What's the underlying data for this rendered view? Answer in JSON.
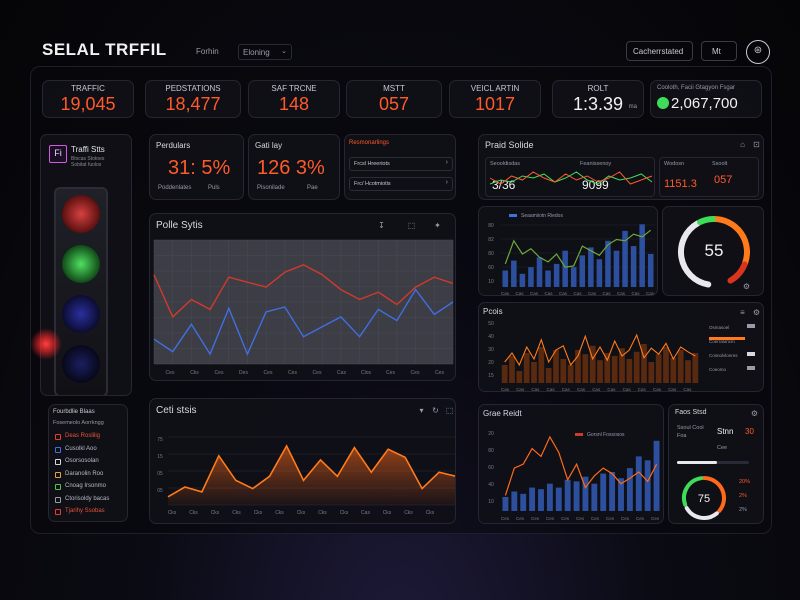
{
  "header": {
    "title": "SELAL TRFFIL",
    "nav_label": "Forhin",
    "dropdown_value": "Eloning",
    "right_button": "Cacherrstated",
    "small_button": "Mt"
  },
  "stats": [
    {
      "label": "TRAFFIC",
      "value": "19,045",
      "unit": ""
    },
    {
      "label": "PEDSTATIONS",
      "value": "18,477",
      "unit": ""
    },
    {
      "label": "SAF TRCNE",
      "value": "148",
      "unit": ""
    },
    {
      "label": "MSTT",
      "value": "057",
      "unit": ""
    },
    {
      "label": "VEICL ARTIN",
      "value": "1017",
      "unit": ""
    },
    {
      "label": "ROLT",
      "value": "1:3.39",
      "unit": "ma"
    }
  ],
  "stat_wide": {
    "label": "Cooloth, Facii Gtagyon Fsgar",
    "value": "2,067,700"
  },
  "left_panel": {
    "title": "Traffi Stts",
    "lines": [
      "Blocas Stotoes",
      "Sobitat fuolos"
    ],
    "legend_title": "Fourbdlie Blaas",
    "legend_sub": "Fosemeolo Aorrkngg",
    "legend_items": [
      "Deas Roslilig",
      "Cusolkl Aoo",
      "Osorsosolan",
      "Daranolin Roo",
      "Cnoag Irsonmo",
      "Ctorisoldy bacas",
      "Tjarihy Ssobas"
    ],
    "legend_colors": [
      "#e63b2e",
      "#3f6fe0",
      "#d8d8e0",
      "#e6a23b",
      "#5cbf4a",
      "#9a9aaa",
      "#e63b2e"
    ]
  },
  "mini_stats": {
    "a_label": "Perdulars",
    "a_value": "31: 5%",
    "a_sub1": "Poddenlates",
    "a_sub2": "Puls",
    "b_label": "Gati lay",
    "b_value": "126 3%",
    "b_sub1": "Pisonilade",
    "b_sub2": "Pae"
  },
  "list_panel": {
    "title": "Resmonarlings",
    "rows": [
      "Frcsl Hreeriots",
      "Frc/ Hcotmiotis"
    ]
  },
  "line_panel": {
    "title": "Polle Sytis",
    "x_ticks": [
      "Ces",
      "Cks",
      "Ces",
      "Des",
      "Ces",
      "Ces",
      "Ces",
      "Cas",
      "Clos",
      "Ces",
      "Ces",
      "Ces"
    ]
  },
  "area_panel": {
    "title": "Ceti stsis",
    "y_ticks": [
      "75",
      "15",
      "05",
      "05"
    ],
    "x_ticks": [
      "Cks",
      "Cks",
      "Cks",
      "Cks",
      "Cks",
      "Cks",
      "Cks",
      "Cks",
      "Cks",
      "Cas",
      "Cks",
      "Cks",
      "Cks"
    ]
  },
  "right_top": {
    "title": "Praid Solide",
    "c1_label": "Seooldisdas",
    "c1_value": "3/36",
    "c2_label": "Feanissenoy",
    "c2_value": "9099",
    "c3_label": "Wodosn",
    "c3_value": "1151.3",
    "c4_label": "Ssoolt",
    "c4_value": "057"
  },
  "bar_panel": {
    "legend": "Seaamiiotn Riedos",
    "y_ticks": [
      "80",
      "82",
      "80",
      "60",
      "10"
    ],
    "x_ticks": [
      "Cas",
      "Cas",
      "Cas",
      "Cas",
      "Cas",
      "Cas",
      "Cas",
      "Cas",
      "Cas",
      "Cas",
      "Cas"
    ]
  },
  "gauge1": {
    "value": "55"
  },
  "orange_panel": {
    "title": "Pcois",
    "y_ticks": [
      "50",
      "40",
      "30",
      "20",
      "15"
    ],
    "legend": [
      "Osmasoel",
      "Coerraloncm",
      "Cosnolvlonres",
      "Coeomo"
    ],
    "x_ticks": [
      "Cas",
      "Cas",
      "Cas",
      "Cas",
      "Cas",
      "Cas",
      "Cas",
      "Cas",
      "Cas",
      "Cas",
      "Cas",
      "Cas",
      "Cas"
    ]
  },
  "bottom_bar_panel": {
    "title": "Grae Reidt",
    "legend": "Gorsnl Fossosos",
    "y_ticks": [
      "20",
      "80",
      "60",
      "40",
      "10"
    ],
    "x_ticks": [
      "Ces",
      "Ces",
      "Ces",
      "Ces",
      "Ces",
      "Ces",
      "Ces",
      "Ces",
      "Ces",
      "Ces",
      "Ces"
    ]
  },
  "small_panel": {
    "title": "Faos Stsd",
    "rows": [
      "Ssoul Cool",
      "Foa"
    ],
    "values": [
      "Stnn",
      "Cee",
      "30"
    ],
    "gauge_value": "75",
    "side": [
      "20%",
      "2%",
      "2%"
    ]
  },
  "colors": {
    "accent": "#ff5a2a",
    "green": "#3fdc5a",
    "blue": "#3f6fe0",
    "panel": "#10101a"
  },
  "chart_data": [
    {
      "type": "line",
      "series": [
        {
          "values": [
            72,
            38,
            52,
            44,
            70,
            66,
            62,
            74,
            80,
            72,
            60,
            52,
            58,
            48,
            62,
            70,
            65
          ]
        },
        {
          "values": [
            20,
            10,
            32,
            8,
            45,
            8,
            42,
            46,
            22,
            30,
            38,
            22,
            44,
            35,
            60,
            40,
            50
          ]
        }
      ]
    },
    {
      "type": "area",
      "series": [
        {
          "values": [
            10,
            22,
            16,
            60,
            30,
            20,
            35,
            72,
            30,
            55,
            35,
            70,
            40,
            68,
            58,
            20,
            40,
            35
          ]
        }
      ]
    },
    {
      "type": "bar",
      "series": [
        {
          "values": [
            25,
            40,
            20,
            30,
            45,
            25,
            35,
            55,
            30,
            48,
            60,
            42,
            70,
            55,
            85,
            62,
            95,
            50
          ]
        },
        {
          "values": [
            35,
            70,
            50,
            58,
            45,
            38,
            50,
            30,
            32,
            62,
            55,
            48,
            64,
            72,
            70,
            80,
            76,
            86
          ]
        }
      ]
    },
    {
      "type": "bar",
      "series": [
        {
          "values": [
            30,
            45,
            20,
            50,
            35,
            60,
            25,
            55,
            40,
            30,
            55,
            48,
            62,
            38,
            50,
            45,
            58,
            40,
            52,
            65,
            35,
            48,
            60,
            42,
            55,
            38,
            50
          ]
        },
        {
          "values": [
            35,
            50,
            30,
            60,
            40,
            72,
            35,
            55,
            62,
            30,
            45,
            78,
            40,
            60,
            38,
            70,
            45,
            55,
            80,
            42,
            58,
            48,
            66,
            40,
            60,
            52,
            45
          ]
        }
      ]
    },
    {
      "type": "bar",
      "series": [
        {
          "values": [
            18,
            25,
            22,
            30,
            28,
            35,
            30,
            40,
            38,
            44,
            35,
            48,
            50,
            42,
            55,
            70,
            65,
            90
          ]
        },
        {
          "values": [
            20,
            55,
            60,
            80,
            70,
            95,
            75,
            40,
            60,
            30,
            45,
            55,
            48,
            35,
            42,
            50,
            38,
            60
          ]
        }
      ]
    }
  ]
}
